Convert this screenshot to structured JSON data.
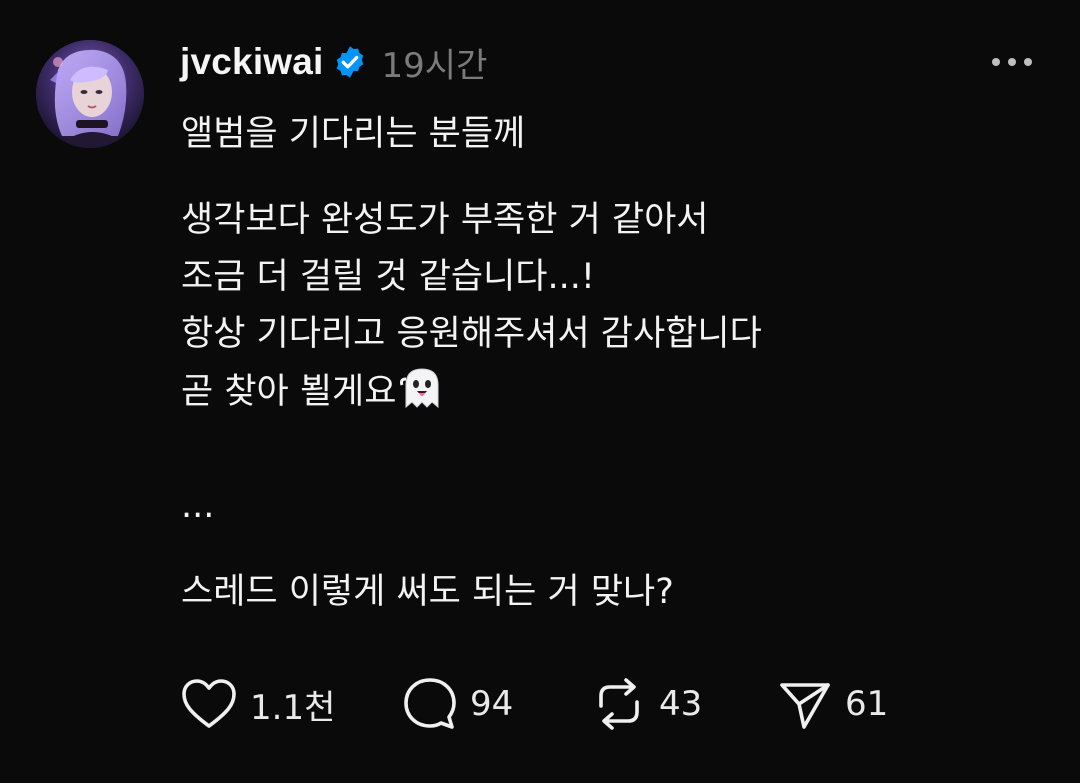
{
  "post": {
    "username": "jvckiwai",
    "verified": true,
    "time": "19시간",
    "lines": {
      "l1": "앨범을 기다리는 분들께",
      "l2": "생각보다 완성도가 부족한 거 같아서",
      "l3": "조금 더 걸릴 것 같습니다...!",
      "l4": "항상 기다리고 응원해주셔서 감사합니다",
      "l5": "곧 찾아 뵐게요",
      "l6": "...",
      "l7": "스레드 이렇게 써도 되는 거 맞나?"
    },
    "emoji": "ghost"
  },
  "actions": {
    "likes": "1.1천",
    "comments": "94",
    "reposts": "43",
    "shares": "61"
  },
  "icons": {
    "like": "heart-icon",
    "comment": "comment-bubble-icon",
    "repost": "repost-icon",
    "share": "send-icon",
    "more": "more-horizontal-icon",
    "verified": "verified-badge-icon"
  },
  "colors": {
    "background": "#0a0a0a",
    "text": "#f3f3f3",
    "muted": "#7b7b7b",
    "verified": "#0095f6"
  }
}
